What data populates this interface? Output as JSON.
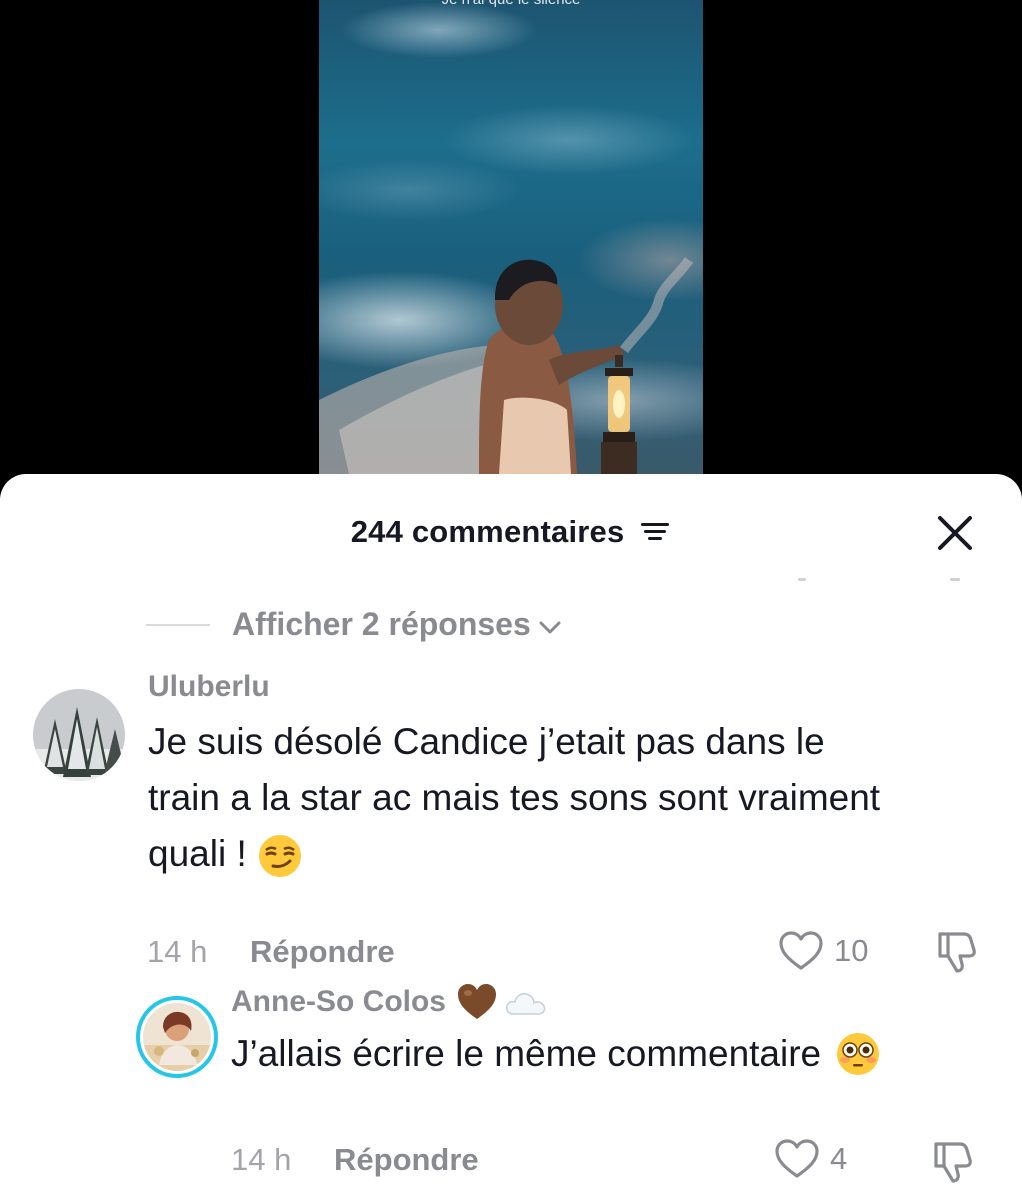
{
  "video": {
    "caption": "Je n'ai que le silence"
  },
  "sheet": {
    "count_label": "244 commentaires",
    "replies_toggle_label": "Afficher 2 réponses",
    "close_icon": "close-icon",
    "sort_icon": "sort-filter-icon"
  },
  "comments": [
    {
      "username": "Uluberlu",
      "text_line1": "Je suis désolé Candice j’etait pas dans le",
      "text_line2": "train a la star ac mais tes sons sont vraiment",
      "text_line3": "quali !",
      "emoji": "smirking-face",
      "time": "14 h",
      "reply_label": "Répondre",
      "likes": "10",
      "avatar": "snowy-forest-avatar"
    },
    {
      "username": "Anne-So Colos",
      "name_emojis": [
        "brown-heart",
        "cloud"
      ],
      "text": "J’allais écrire le même commentaire",
      "emoji": "flushed-face",
      "time": "14 h",
      "reply_label": "Répondre",
      "likes": "4",
      "avatar": "portrait-avatar",
      "avatar_ring_color": "#25c6e8"
    }
  ],
  "colors": {
    "text_primary": "#161823",
    "text_secondary": "#8a8b91",
    "story_ring": "#25c6e8"
  }
}
